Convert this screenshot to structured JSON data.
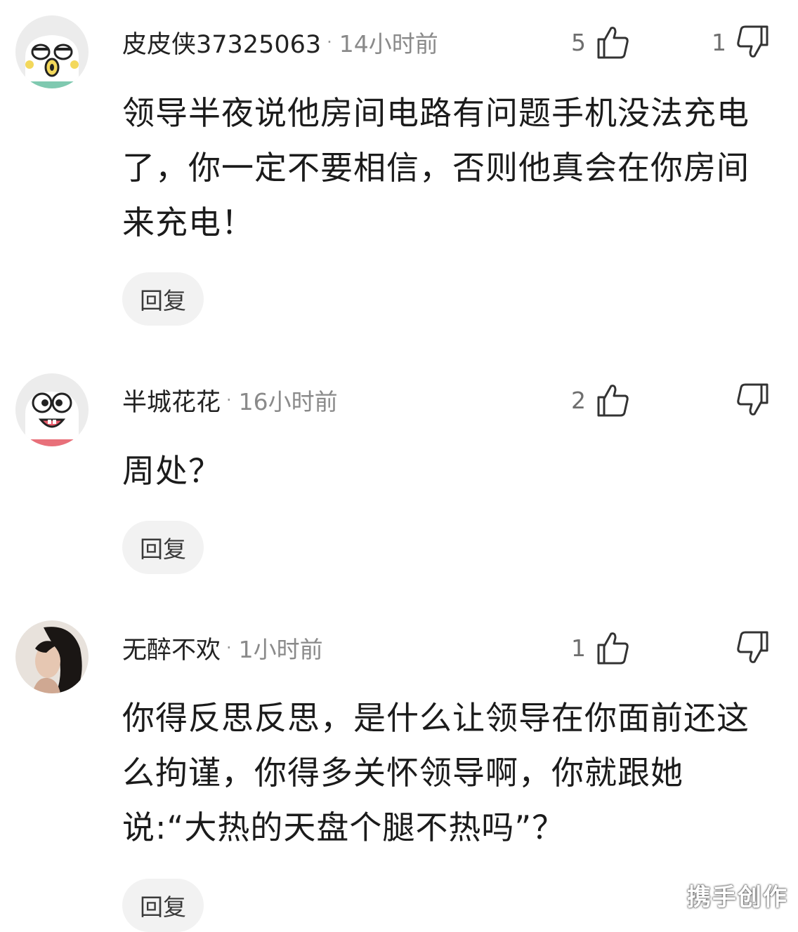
{
  "comments": [
    {
      "username": "皮皮侠37325063",
      "separator": "·",
      "time": "14小时前",
      "like_count": "5",
      "dislike_count": "1",
      "text": "领导半夜说他房间电路有问题手机没法充电了，你一定不要相信，否则他真会在你房间来充电！",
      "reply_label": "回复"
    },
    {
      "username": "半城花花",
      "separator": "·",
      "time": "16小时前",
      "like_count": "2",
      "dislike_count": "",
      "text": "周处？",
      "reply_label": "回复"
    },
    {
      "username": "无醉不欢",
      "separator": "·",
      "time": "1小时前",
      "like_count": "1",
      "dislike_count": "",
      "text": "你得反思反思，是什么让领导在你面前还这么拘谨，你得多关怀领导啊，你就跟她说:“大热的天盘个腿不热吗”？",
      "reply_label": "回复"
    }
  ],
  "watermark": "携手创作"
}
